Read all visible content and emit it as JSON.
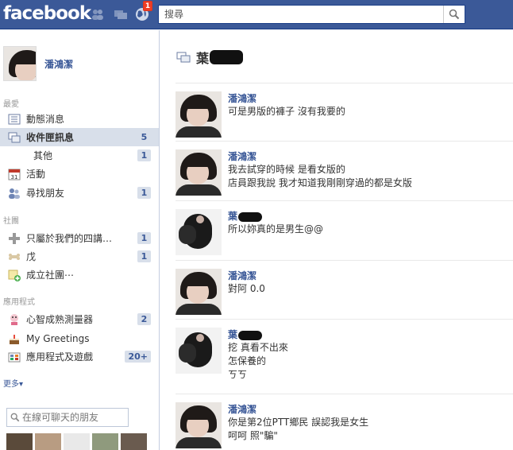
{
  "topbar": {
    "logo": "facebook",
    "notifications_count": "1",
    "search_placeholder": "搜尋"
  },
  "sidebar": {
    "profile_name": "潘鴻潔",
    "favorites_label": "最愛",
    "favorites": [
      {
        "label": "動態消息",
        "icon": "news-feed-icon",
        "count": ""
      },
      {
        "label": "收件匣訊息",
        "icon": "messages-icon",
        "count": "5",
        "active": true
      },
      {
        "label": "其他",
        "icon": "",
        "count": "1"
      },
      {
        "label": "活動",
        "icon": "calendar-icon",
        "count": ""
      },
      {
        "label": "尋找朋友",
        "icon": "friends-icon",
        "count": "1"
      }
    ],
    "groups_label": "社團",
    "groups": [
      {
        "label": "只屬於我們的四講…",
        "icon": "group-plus-icon",
        "count": "1"
      },
      {
        "label": "戊",
        "icon": "bone-icon",
        "count": "1"
      },
      {
        "label": "成立社團⋯",
        "icon": "create-group-icon",
        "count": ""
      }
    ],
    "apps_label": "應用程式",
    "apps": [
      {
        "label": "心智成熟測量器",
        "icon": "app-icon",
        "count": "2"
      },
      {
        "label": "My Greetings",
        "icon": "cake-icon",
        "count": ""
      },
      {
        "label": "應用程式及遊戲",
        "icon": "games-icon",
        "count": "20+"
      }
    ],
    "more_label": "更多▾",
    "chat_search_placeholder": "在線可聊天的朋友"
  },
  "conversation": {
    "title": "葉",
    "messages": [
      {
        "author": "潘鴻潔",
        "who": "me",
        "lines": [
          "可是男版的褲子 沒有我要的"
        ]
      },
      {
        "author": "潘鴻潔",
        "who": "me",
        "lines": [
          "我去試穿的時候 是看女版的",
          "店員跟我說 我才知道我剛剛穿過的都是女版"
        ]
      },
      {
        "author": "葉",
        "who": "other",
        "lines": [
          "所以妳真的是男生@@"
        ]
      },
      {
        "author": "潘鴻潔",
        "who": "me",
        "lines": [
          "對阿 0.0"
        ]
      },
      {
        "author": "葉",
        "who": "other",
        "lines": [
          "挖 真看不出來",
          "怎保養的",
          "ㄎㄎ"
        ]
      },
      {
        "author": "潘鴻潔",
        "who": "me",
        "lines": [
          "你是第2位PTT鄉民 誤認我是女生",
          "呵呵 照\"騙\""
        ]
      }
    ]
  },
  "colors": {
    "brand": "#3b5998",
    "active_nav": "#d8dfea",
    "notification": "#f03d25"
  }
}
